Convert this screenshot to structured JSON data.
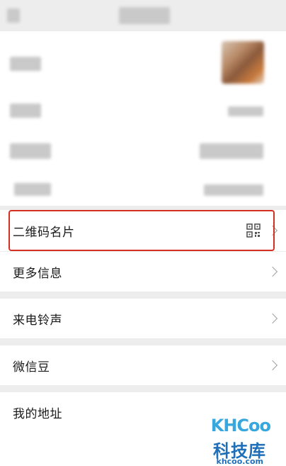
{
  "rows": {
    "qr_card": "二维码名片",
    "more_info": "更多信息",
    "ringtone": "来电铃声",
    "wechat_beans": "微信豆",
    "my_address": "我的地址"
  },
  "watermark": {
    "logo": "KHCoo",
    "name": "科技库",
    "url": "khcoo.com"
  },
  "colors": {
    "highlight": "#d42f22",
    "watermark_primary": "#1e6fb8"
  }
}
